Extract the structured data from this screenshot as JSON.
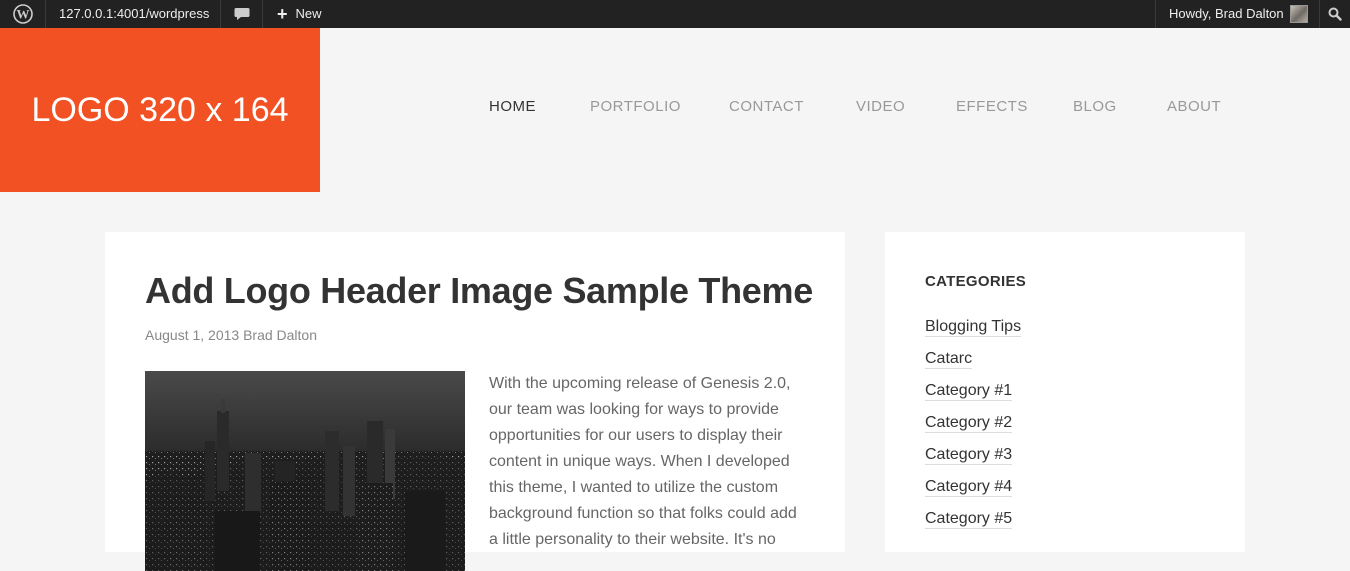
{
  "admin_bar": {
    "site_url": "127.0.0.1:4001/wordpress",
    "new_label": "New",
    "greeting": "Howdy, Brad Dalton"
  },
  "header": {
    "logo_text": "LOGO 320 x 164",
    "nav": [
      "HOME",
      "PORTFOLIO",
      "CONTACT",
      "VIDEO",
      "EFFECTS",
      "BLOG",
      "ABOUT"
    ],
    "active_nav": "HOME"
  },
  "post": {
    "title": "Add Logo Header Image Sample Theme",
    "date": "August 1, 2013",
    "author": "Brad Dalton",
    "body": "With the upcoming release of Genesis 2.0, our team was looking for ways to provide opportunities for our users to display their content in unique ways. When I developed this theme, I wanted to utilize the custom background function so that folks could add a little personality to their website. It's no"
  },
  "sidebar": {
    "widget_title": "CATEGORIES",
    "categories": [
      "Blogging Tips",
      "Catarc",
      "Category #1",
      "Category #2",
      "Category #3",
      "Category #4",
      "Category #5"
    ]
  },
  "colors": {
    "admin_bar_bg": "#222222",
    "logo_bg": "#f15123",
    "page_bg": "#f5f5f5"
  }
}
